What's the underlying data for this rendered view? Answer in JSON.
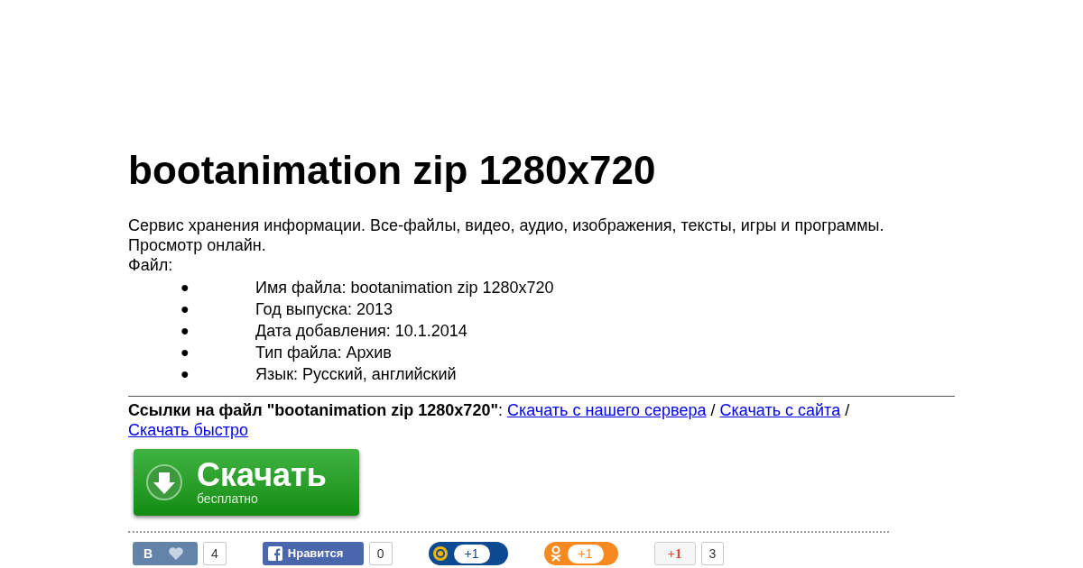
{
  "title": "bootanimation zip 1280x720",
  "intro": [
    "Сервис хранения информации. Все-файлы, видео, аудио, изображения, тексты, игры и программы.",
    "Просмотр онлайн.",
    "Файл:"
  ],
  "file_details": [
    {
      "bullet": "●",
      "text": "Имя файла: bootanimation zip 1280x720"
    },
    {
      "bullet": "●",
      "text": "Год выпуска: 2013"
    },
    {
      "bullet": "●",
      "text": "Дата добавления: 10.1.2014"
    },
    {
      "bullet": "●",
      "text": "Тип файла: Архив"
    },
    {
      "bullet": "●",
      "text": "Язык: Русский, английский"
    }
  ],
  "links": {
    "label": "Ссылки на файл \"bootanimation zip 1280x720\"",
    "colon": ":",
    "items": [
      {
        "text": "Скачать с нашего сервера"
      },
      {
        "text": "Скачать с сайта"
      },
      {
        "text": "Скачать быстро"
      }
    ],
    "separator": "/"
  },
  "download_button": {
    "title": "Скачать",
    "subtitle": "бесплатно"
  },
  "social": [
    {
      "kind": "vk",
      "label": "В",
      "count": "4"
    },
    {
      "kind": "facebook",
      "label": "Нравится",
      "count": "0"
    },
    {
      "kind": "mail",
      "label": "+1"
    },
    {
      "kind": "ok",
      "label": "+1"
    },
    {
      "kind": "gplus",
      "label": "+1",
      "count": "3"
    }
  ]
}
